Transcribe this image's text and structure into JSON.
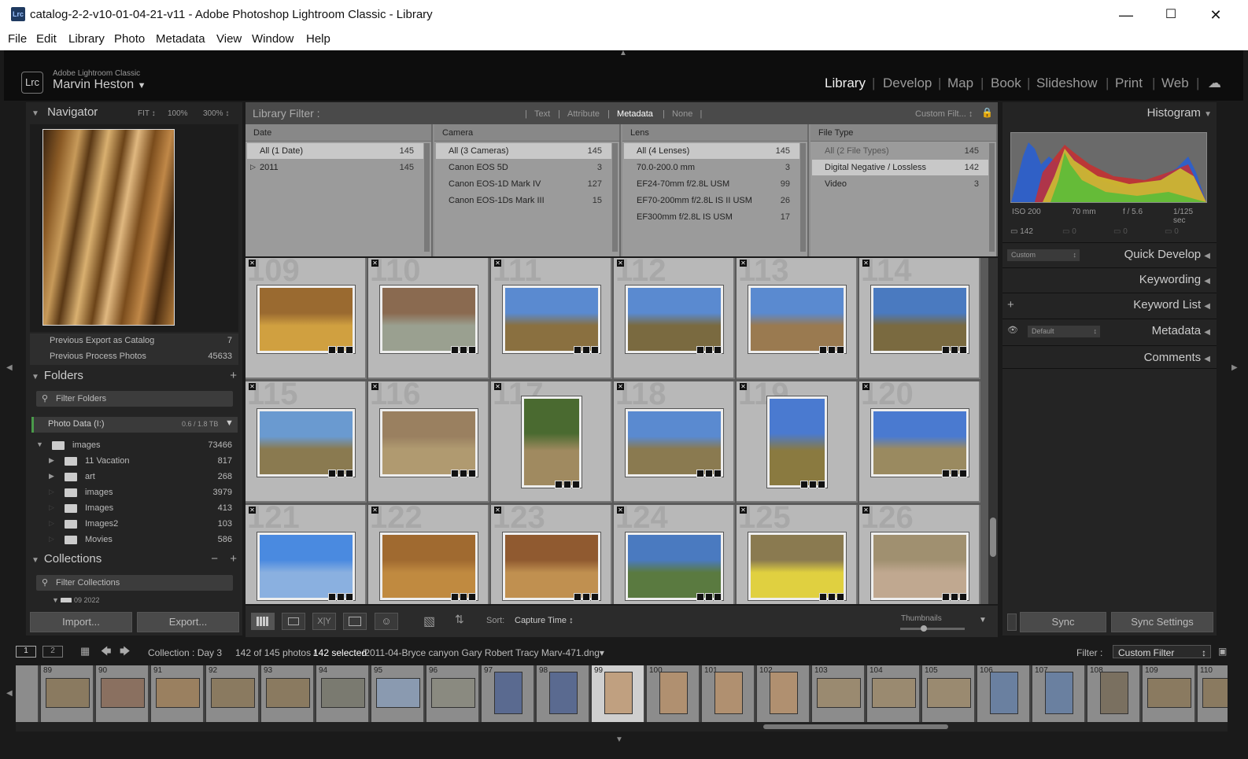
{
  "window": {
    "title": "catalog-2-2-v10-01-04-21-v11 - Adobe Photoshop Lightroom Classic - Library",
    "icon": "Lrc"
  },
  "menu": [
    "File",
    "Edit",
    "Library",
    "Photo",
    "Metadata",
    "View",
    "Window",
    "Help"
  ],
  "identity": {
    "badge": "Lrc",
    "app": "Adobe Lightroom Classic",
    "user": "Marvin Heston"
  },
  "modules": [
    "Library",
    "Develop",
    "Map",
    "Book",
    "Slideshow",
    "Print",
    "Web"
  ],
  "navigator": {
    "title": "Navigator",
    "zoom": [
      "FIT",
      "100%",
      "300%"
    ]
  },
  "catalog_rows": [
    {
      "label": "Previous Export as Catalog",
      "count": "7"
    },
    {
      "label": "Previous Process Photos",
      "count": "45633"
    }
  ],
  "folders": {
    "title": "Folders",
    "filter_placeholder": "Filter Folders",
    "volume": {
      "name": "Photo Data (I:)",
      "space": "0.6 / 1.8 TB"
    },
    "items": [
      {
        "label": "images",
        "count": "73466",
        "level": 0,
        "arrow": "▼"
      },
      {
        "label": "11 Vacation",
        "count": "817",
        "level": 1,
        "arrow": "▶"
      },
      {
        "label": "art",
        "count": "268",
        "level": 1,
        "arrow": "▶"
      },
      {
        "label": "images",
        "count": "3979",
        "level": 1,
        "arrow": ""
      },
      {
        "label": "Images",
        "count": "413",
        "level": 1,
        "arrow": ""
      },
      {
        "label": "Images2",
        "count": "103",
        "level": 1,
        "arrow": ""
      },
      {
        "label": "Movies",
        "count": "586",
        "level": 1,
        "arrow": ""
      }
    ]
  },
  "collections": {
    "title": "Collections",
    "filter_placeholder": "Filter Collections",
    "partial": "09 2022"
  },
  "left_buttons": {
    "import": "Import...",
    "export": "Export..."
  },
  "library_filter": {
    "title": "Library Filter :",
    "tabs": [
      "Text",
      "Attribute",
      "Metadata",
      "None"
    ],
    "active_tab": "Metadata",
    "preset": "Custom Filt...",
    "columns": [
      {
        "header": "Date",
        "items": [
          {
            "label": "All (1 Date)",
            "count": "145",
            "sel": true
          },
          {
            "label": "2011",
            "count": "145",
            "sel": false,
            "arrow": "▷"
          }
        ]
      },
      {
        "header": "Camera",
        "items": [
          {
            "label": "All (3 Cameras)",
            "count": "145",
            "sel": true
          },
          {
            "label": "Canon EOS 5D",
            "count": "3"
          },
          {
            "label": "Canon EOS-1D Mark IV",
            "count": "127"
          },
          {
            "label": "Canon EOS-1Ds Mark III",
            "count": "15"
          }
        ]
      },
      {
        "header": "Lens",
        "items": [
          {
            "label": "All (4 Lenses)",
            "count": "145",
            "sel": true
          },
          {
            "label": "70.0-200.0 mm",
            "count": "3"
          },
          {
            "label": "EF24-70mm f/2.8L USM",
            "count": "99"
          },
          {
            "label": "EF70-200mm f/2.8L IS II USM",
            "count": "26"
          },
          {
            "label": "EF300mm f/2.8L IS USM",
            "count": "17"
          }
        ]
      },
      {
        "header": "File Type",
        "items": [
          {
            "label": "All (2 File Types)",
            "count": "145",
            "dim": true
          },
          {
            "label": "Digital Negative / Lossless",
            "count": "142",
            "sel": true
          },
          {
            "label": "Video",
            "count": "3"
          }
        ]
      }
    ]
  },
  "grid": {
    "cells": [
      {
        "n": "109",
        "c1": "#9a6a30",
        "c2": "#d0a040"
      },
      {
        "n": "110",
        "c1": "#8a6a50",
        "c2": "#9aa090"
      },
      {
        "n": "111",
        "c1": "#5a8ad0",
        "c2": "#8a7040"
      },
      {
        "n": "112",
        "c1": "#5a8ad0",
        "c2": "#7a6a40"
      },
      {
        "n": "113",
        "c1": "#5a8ad0",
        "c2": "#9a7a50"
      },
      {
        "n": "114",
        "c1": "#4a7ac0",
        "c2": "#7a6a40"
      },
      {
        "n": "115",
        "c1": "#6a9ad0",
        "c2": "#8a7a50"
      },
      {
        "n": "116",
        "c1": "#9a8060",
        "c2": "#b09a70"
      },
      {
        "n": "117",
        "c1": "#4a6a30",
        "c2": "#a08a60"
      },
      {
        "n": "118",
        "c1": "#5a8ad0",
        "c2": "#8a7a50"
      },
      {
        "n": "119",
        "c1": "#4a7ad0",
        "c2": "#8a7a40"
      },
      {
        "n": "120",
        "c1": "#4a7ad0",
        "c2": "#9a8a60"
      },
      {
        "n": "121",
        "c1": "#4a8ae0",
        "c2": "#8ab0e0"
      },
      {
        "n": "122",
        "c1": "#a06a30",
        "c2": "#c08a40"
      },
      {
        "n": "123",
        "c1": "#905a30",
        "c2": "#c09050"
      },
      {
        "n": "124",
        "c1": "#4a7ac0",
        "c2": "#5a7a40"
      },
      {
        "n": "125",
        "c1": "#8a7a50",
        "c2": "#e0d040"
      },
      {
        "n": "126",
        "c1": "#a09070",
        "c2": "#c0a890"
      }
    ]
  },
  "toolbar": {
    "sort_label": "Sort:",
    "sort_value": "Capture Time",
    "thumbs_label": "Thumbnails"
  },
  "histogram": {
    "title": "Histogram",
    "iso": "ISO 200",
    "focal": "70 mm",
    "aperture": "f / 5.6",
    "shutter": "1/125 sec",
    "count": "142",
    "zero1": "0",
    "zero2": "0",
    "zero3": "0"
  },
  "right_panels": {
    "quick_preset": "Custom",
    "quick": "Quick Develop",
    "keywording": "Keywording",
    "keyword_list": "Keyword List",
    "meta_preset": "Default",
    "metadata": "Metadata",
    "comments": "Comments"
  },
  "sync": {
    "sync": "Sync",
    "sync_settings": "Sync Settings"
  },
  "filmstrip": {
    "page1": "1",
    "page2": "2",
    "info_pre": "Collection : Day 3",
    "info_count": "142 of 145 photos /",
    "info_sel": "142 selected",
    "info_file": "/2011-04-Bryce canyon Gary Robert Tracy Marv-471.dng",
    "filter_label": "Filter :",
    "filter_value": "Custom Filter",
    "frames": [
      "89",
      "90",
      "91",
      "92",
      "93",
      "94",
      "95",
      "96",
      "97",
      "98",
      "99",
      "100",
      "101",
      "102",
      "103",
      "104",
      "105",
      "106",
      "107",
      "108",
      "109",
      "110"
    ]
  }
}
